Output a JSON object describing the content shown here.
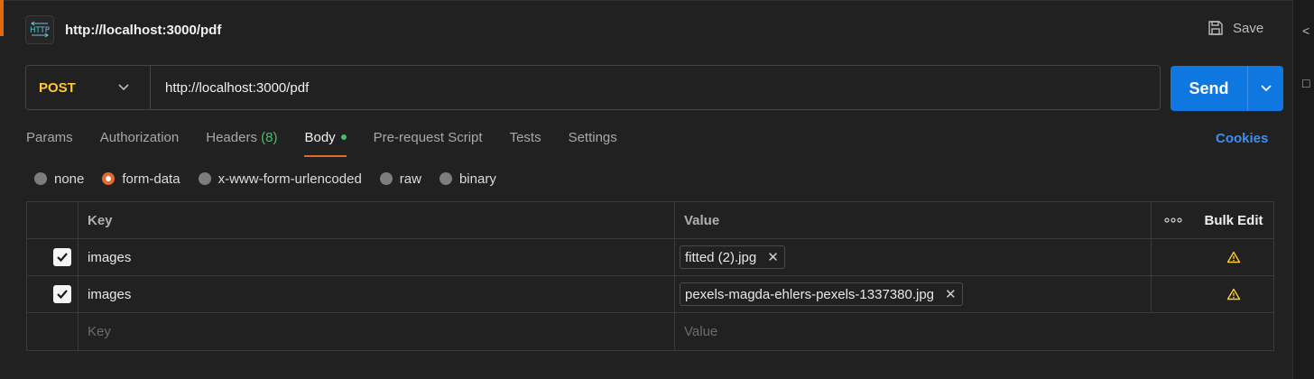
{
  "header": {
    "icon": "http-icon",
    "title": "http://localhost:3000/pdf",
    "save_label": "Save"
  },
  "request": {
    "method": "POST",
    "url": "http://localhost:3000/pdf",
    "send_label": "Send"
  },
  "tabs": [
    {
      "label": "Params"
    },
    {
      "label": "Authorization"
    },
    {
      "label": "Headers",
      "count": "(8)"
    },
    {
      "label": "Body",
      "active": true,
      "indicator": "green-dot"
    },
    {
      "label": "Pre-request Script"
    },
    {
      "label": "Tests"
    },
    {
      "label": "Settings"
    }
  ],
  "cookies_label": "Cookies",
  "body_types": [
    {
      "label": "none",
      "selected": false
    },
    {
      "label": "form-data",
      "selected": true
    },
    {
      "label": "x-www-form-urlencoded",
      "selected": false
    },
    {
      "label": "raw",
      "selected": false
    },
    {
      "label": "binary",
      "selected": false
    }
  ],
  "table": {
    "headers": {
      "key": "Key",
      "value": "Value",
      "bulk_edit": "Bulk Edit"
    },
    "rows": [
      {
        "checked": true,
        "key": "images",
        "file": "fitted (2).jpg",
        "warning": true
      },
      {
        "checked": true,
        "key": "images",
        "file": "pexels-magda-ehlers-pexels-1337380.jpg",
        "warning": true
      }
    ],
    "empty_row": {
      "key_placeholder": "Key",
      "value_placeholder": "Value"
    }
  },
  "colors": {
    "accent": "#0f77e0",
    "method": "#ffca2b",
    "active_tab": "#e26831",
    "cookies": "#3b8ff2",
    "count": "#4cbb6c",
    "warning": "#ffca2b"
  }
}
